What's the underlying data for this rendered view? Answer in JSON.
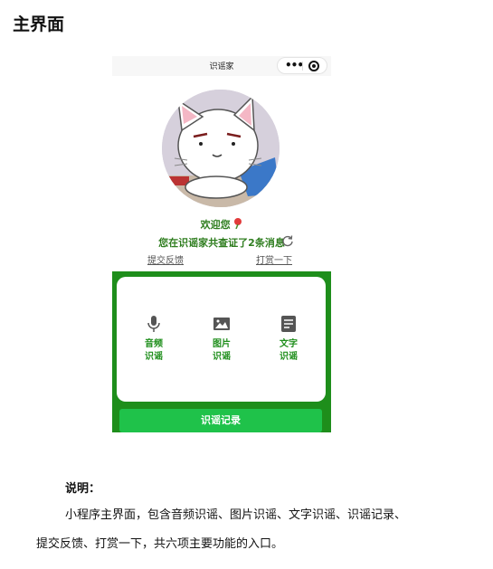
{
  "document": {
    "heading": "主界面",
    "note_label": "说明：",
    "note_line1": "小程序主界面，包含音频识谣、图片识谣、文字识谣、识谣记录、",
    "note_line2": "提交反馈、打赏一下，共六项主要功能的入口。"
  },
  "app": {
    "nav_title": "识谣家",
    "capsule": {
      "more_icon": "ellipsis-icon",
      "close_icon": "target-icon"
    },
    "welcome": "欢迎您",
    "welcome_icon": "lollipop-icon",
    "count_text": "您在识谣家共查证了2条消息",
    "refresh_icon": "refresh-icon",
    "links": {
      "feedback": "提交反馈",
      "tip": "打赏一下"
    },
    "features": [
      {
        "label_line1": "音频",
        "label_line2": "识谣",
        "icon": "microphone-icon"
      },
      {
        "label_line1": "图片",
        "label_line2": "识谣",
        "icon": "image-icon"
      },
      {
        "label_line1": "文字",
        "label_line2": "识谣",
        "icon": "document-icon"
      }
    ],
    "history_button": "识谣记录",
    "colors": {
      "primary_green": "#1e8e1b",
      "button_green": "#1fc24a",
      "text_green": "#2e7d1e"
    }
  }
}
